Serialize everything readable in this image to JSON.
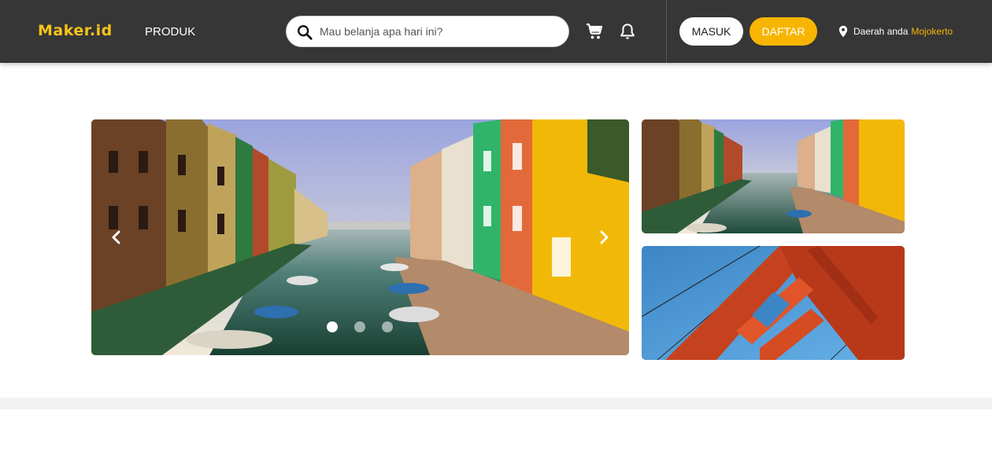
{
  "header": {
    "logo": "Maker.id",
    "nav_produk": "PRODUK",
    "search_placeholder": "Mau belanja apa hari ini?",
    "btn_masuk": "MASUK",
    "btn_daftar": "DAFTAR",
    "region_label": "Daerah anda",
    "region_city": "Mojokerto",
    "icons": [
      "search-icon",
      "cart-icon",
      "bell-icon",
      "location-pin-icon"
    ]
  },
  "colors": {
    "header_bg": "#363636",
    "accent": "#f7b500",
    "logo": "#f5c518"
  },
  "carousel": {
    "slide_count": 3,
    "active_slide": 1,
    "icons": [
      "chevron-left-icon",
      "chevron-right-icon"
    ]
  }
}
